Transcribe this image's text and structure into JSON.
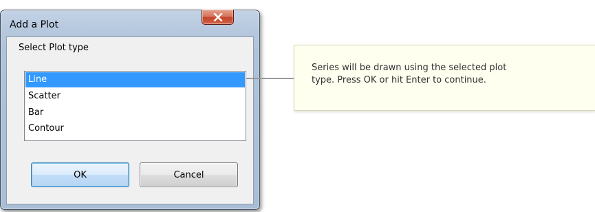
{
  "dialog": {
    "title": "Add a Plot",
    "close_icon": "close-x-icon",
    "prompt": "Select Plot type",
    "plot_types": [
      {
        "label": "Line",
        "selected": true
      },
      {
        "label": "Scatter",
        "selected": false
      },
      {
        "label": "Bar",
        "selected": false
      },
      {
        "label": "Contour",
        "selected": false
      }
    ],
    "ok_label": "OK",
    "cancel_label": "Cancel"
  },
  "callout": {
    "line1": "Series will be drawn using the selected plot",
    "line2": "type. Press OK or hit Enter to continue."
  },
  "colors": {
    "selection": "#3399ff",
    "close_button": "#c4452a",
    "callout_background": "#fffff0"
  }
}
